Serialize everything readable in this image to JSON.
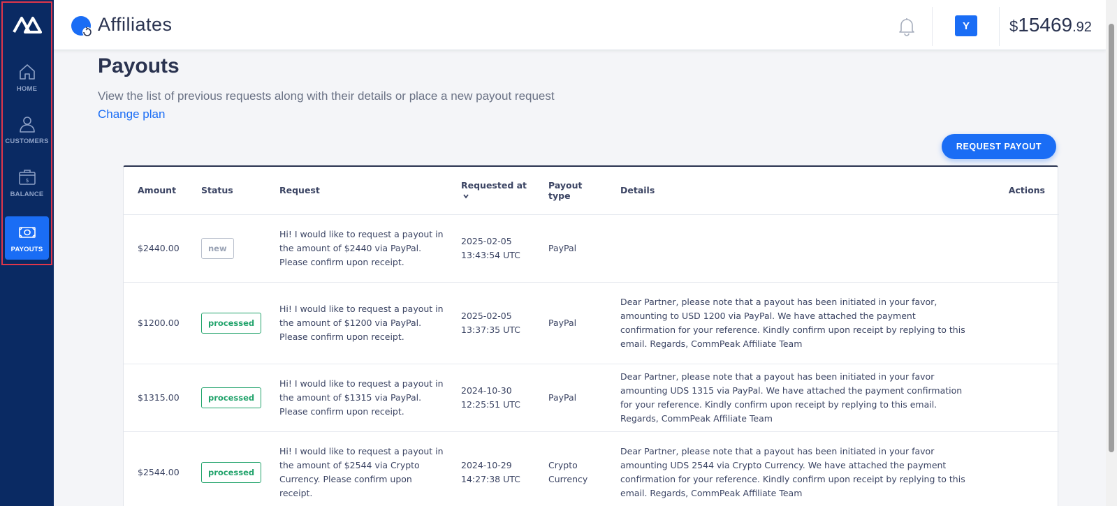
{
  "app": {
    "title": "Affiliates",
    "balance": {
      "currency": "$",
      "integer": "15469",
      "decimal": ".92"
    },
    "avatar_initial": "Y"
  },
  "sidebar": {
    "items": [
      {
        "label": "HOME",
        "icon": "home-icon",
        "active": false
      },
      {
        "label": "CUSTOMERS",
        "icon": "user-icon",
        "active": false
      },
      {
        "label": "BALANCE",
        "icon": "wallet-icon",
        "active": false
      },
      {
        "label": "PAYOUTS",
        "icon": "cash-icon",
        "active": true
      }
    ]
  },
  "page": {
    "title": "Payouts",
    "subtitle": "View the list of previous requests along with their details or place a new payout request",
    "change_plan": "Change plan",
    "request_button": "REQUEST PAYOUT"
  },
  "table": {
    "headers": {
      "amount": "Amount",
      "status": "Status",
      "request": "Request",
      "requested_at": "Requested at",
      "payout_type_1": "Payout",
      "payout_type_2": "type",
      "details": "Details",
      "actions": "Actions"
    },
    "rows": [
      {
        "amount": "$2440.00",
        "status": "new",
        "request": "Hi! I would like to request a payout in the amount of $2440 via PayPal. Please confirm upon receipt.",
        "date": "2025-02-05",
        "time": "13:43:54 UTC",
        "payout_type": "PayPal",
        "details": ""
      },
      {
        "amount": "$1200.00",
        "status": "processed",
        "request": "Hi! I would like to request a payout in the amount of $1200 via PayPal. Please confirm upon receipt.",
        "date": "2025-02-05",
        "time": "13:37:35 UTC",
        "payout_type": "PayPal",
        "details": "Dear Partner, please note that a payout has been initiated in your favor, amounting to USD 1200 via PayPal. We have attached the payment confirmation for your reference. Kindly confirm upon receipt by replying to this email. Regards, CommPeak Affiliate Team"
      },
      {
        "amount": "$1315.00",
        "status": "processed",
        "request": "Hi! I would like to request a payout in the amount of $1315 via PayPal. Please confirm upon receipt.",
        "date": "2024-10-30",
        "time": "12:25:51 UTC",
        "payout_type": "PayPal",
        "details": "Dear Partner, please note that a payout has been initiated in your favor amounting UDS 1315 via PayPal. We have attached the payment confirmation for your reference. Kindly confirm upon receipt by replying to this email. Regards, CommPeak Affiliate Team"
      },
      {
        "amount": "$2544.00",
        "status": "processed",
        "request": "Hi! I would like to request a payout in the amount of $2544 via Crypto Currency. Please confirm upon receipt.",
        "date": "2024-10-29",
        "time": "14:27:38 UTC",
        "payout_type": "Crypto Currency",
        "details": "Dear Partner, please note that a payout has been initiated in your favor amounting UDS 2544 via Crypto Currency. We have attached the payment confirmation for your reference. Kindly confirm upon receipt by replying to this email. Regards, CommPeak Affiliate Team"
      }
    ]
  },
  "colors": {
    "sidebar_bg": "#0a2a63",
    "accent": "#1a6df5",
    "processed": "#21a36b",
    "highlight": "#e0364a"
  }
}
